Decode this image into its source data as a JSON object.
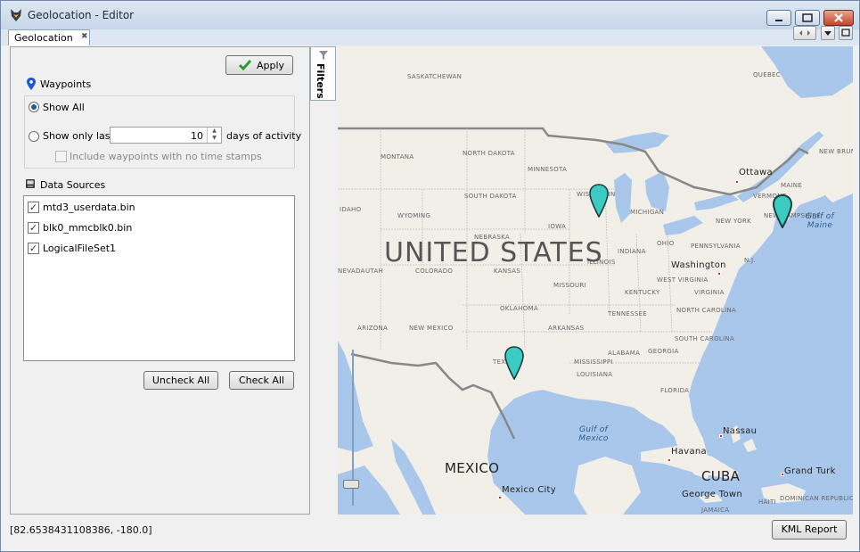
{
  "window": {
    "title": "Geolocation - Editor"
  },
  "tab": {
    "label": "Geolocation",
    "close": "✖"
  },
  "panel": {
    "apply_label": "Apply",
    "waypoints": {
      "header": "Waypoints",
      "show_all": "Show All",
      "show_only_last": "Show only last",
      "days_value": "10",
      "days_suffix": "days of activity",
      "include_no_timestamps": "Include waypoints with no time stamps",
      "selected": "show_all"
    },
    "data_sources": {
      "header": "Data Sources",
      "items": [
        {
          "label": "mtd3_userdata.bin",
          "checked": true
        },
        {
          "label": "blk0_mmcblk0.bin",
          "checked": true
        },
        {
          "label": "LogicalFileSet1",
          "checked": true
        }
      ]
    },
    "uncheck_all": "Uncheck All",
    "check_all": "Check All"
  },
  "filters_tab": "Filters",
  "map": {
    "country_big": "UNITED STATES",
    "countries": [
      "MEXICO",
      "CUBA"
    ],
    "states": [
      "SASKATCHEWAN",
      "QUEBEC",
      "MONTANA",
      "NORTH DAKOTA",
      "MINNESOTA",
      "SOUTH DAKOTA",
      "WISCONSIN",
      "MICHIGAN",
      "IDAHO",
      "WYOMING",
      "NEBRASKA",
      "IOWA",
      "NEW YORK",
      "NEW BRUNSWICK",
      "VERMONT",
      "MAINE",
      "NEW HAMPSHIRE",
      "NEVADA",
      "UTAH",
      "COLORADO",
      "KANSAS",
      "ILLINOIS",
      "INDIANA",
      "OHIO",
      "PENNSYLVANIA",
      "N.J.",
      "MISSOURI",
      "WEST VIRGINIA",
      "VIRGINIA",
      "KENTUCKY",
      "ARIZONA",
      "NEW MEXICO",
      "OKLAHOMA",
      "TENNESSEE",
      "NORTH CAROLINA",
      "ARKANSAS",
      "SOUTH CAROLINA",
      "TEXAS",
      "MISSISSIPPI",
      "ALABAMA",
      "GEORGIA",
      "LOUISIANA",
      "FLORIDA",
      "DOMINICAN REPUBLIC",
      "JAMAICA",
      "HAITI"
    ],
    "cities": [
      "Ottawa",
      "Washington",
      "Mexico City",
      "Havana",
      "Nassau",
      "George Town",
      "Grand Turk"
    ],
    "waters": [
      "Gulf of Maine",
      "Gulf of Mexico"
    ]
  },
  "status": {
    "coordinates": "[82.6538431108386, -180.0]"
  },
  "kml_report": "KML Report",
  "colors": {
    "marker": "#3ccbc3",
    "land": "#f2efe9",
    "water": "#a9c7ea",
    "accent": "#1d58a8"
  }
}
